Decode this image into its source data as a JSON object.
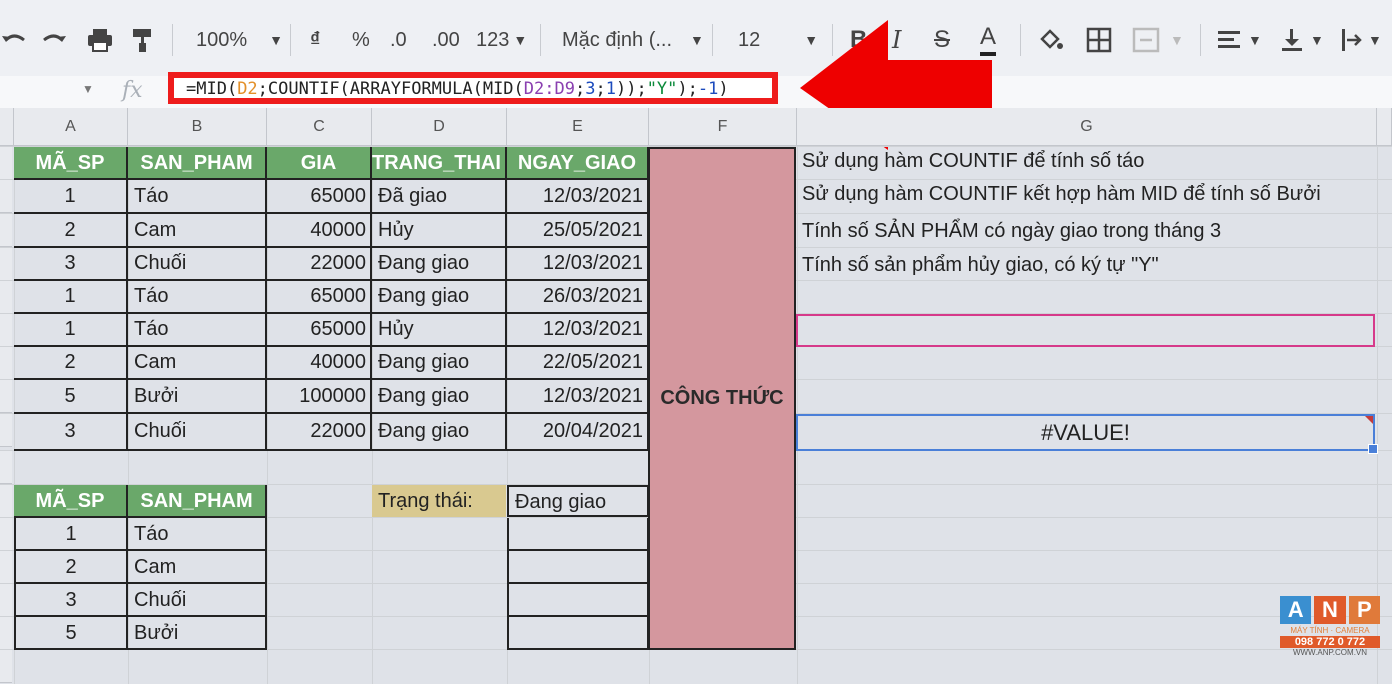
{
  "toolbar": {
    "zoom": "100%",
    "currency": "₫",
    "percent": "%",
    "dec_decrease": ".0",
    "dec_increase": ".00",
    "more_formats": "123",
    "font": "Mặc định (...",
    "font_size": "12"
  },
  "formula_bar": {
    "fx": "fx",
    "f1": "=MID(",
    "f2": "D2",
    "f3": ";COUNTIF(ARRAYFORMULA(MID(",
    "f4": "D2:D9",
    "f5": ";",
    "f6": "3",
    "f7": ";",
    "f8": "1",
    "f9": "));",
    "f10": "\"Y\"",
    "f11": ");",
    "f12": "-1",
    "f13": ")"
  },
  "columns": [
    "A",
    "B",
    "C",
    "D",
    "E",
    "F",
    "G"
  ],
  "table1": {
    "headers": [
      "MÃ_SP",
      "SAN_PHAM",
      "GIA",
      "TRANG_THAI",
      "NGAY_GIAO"
    ],
    "rows": [
      [
        "1",
        "Táo",
        "65000",
        "Đã giao",
        "12/03/2021"
      ],
      [
        "2",
        "Cam",
        "40000",
        "Hủy",
        "25/05/2021"
      ],
      [
        "3",
        "Chuối",
        "22000",
        "Đang giao",
        "12/03/2021"
      ],
      [
        "1",
        "Táo",
        "65000",
        "Đang giao",
        "26/03/2021"
      ],
      [
        "1",
        "Táo",
        "65000",
        "Hủy",
        "12/03/2021"
      ],
      [
        "2",
        "Cam",
        "40000",
        "Đang giao",
        "22/05/2021"
      ],
      [
        "5",
        "Bưởi",
        "100000",
        "Đang giao",
        "12/03/2021"
      ],
      [
        "3",
        "Chuối",
        "22000",
        "Đang giao",
        "20/04/2021"
      ]
    ]
  },
  "table2": {
    "headers": [
      "MÃ_SP",
      "SAN_PHAM"
    ],
    "rows": [
      [
        "1",
        "Táo"
      ],
      [
        "2",
        "Cam"
      ],
      [
        "3",
        "Chuối"
      ],
      [
        "5",
        "Bưởi"
      ]
    ]
  },
  "status": {
    "label": "Trạng thái:",
    "value": "Đang giao"
  },
  "formula_label": "CÔNG THỨC",
  "notes": [
    "Sử dụng hàm COUNTIF để tính số táo",
    "Sử dụng hàm COUNTIF kết hợp hàm MID để tính số Bưởi",
    "Tính số SẢN PHẨM có ngày giao trong tháng 3",
    "Tính số sản phẩm hủy giao, có ký tự \"Y\""
  ],
  "result": "#VALUE!",
  "logo": {
    "letters": [
      "A",
      "N",
      "P"
    ],
    "tagline": "MÁY TÍNH · CAMERA",
    "phone": "098 772 0 772",
    "web": "WWW.ANP.COM.VN"
  },
  "colors": {
    "header_green": "#6aa86a",
    "merge_pink": "#d4979e",
    "status_tan": "#d9c990",
    "highlight_red": "#ee1c1c",
    "selection_blue": "#4a7fd8",
    "magenta_border": "#d63a8a"
  }
}
